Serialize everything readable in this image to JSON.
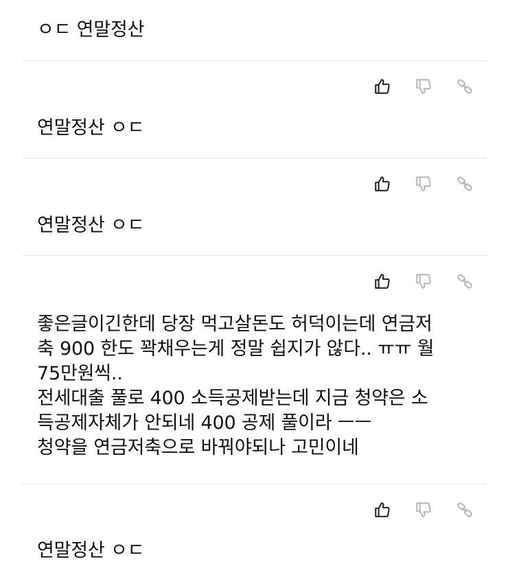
{
  "comments": [
    {
      "text": "ㅇㄷ 연말정산"
    },
    {
      "text": "연말정산 ㅇㄷ"
    },
    {
      "text": "연말정산 ㅇㄷ"
    },
    {
      "text": "좋은글이긴한데 당장 먹고살돈도 허덕이는데 연금저\n축 900 한도 꽉채우는게 정말 쉽지가 않다.. ㅠㅠ 월\n75만원씩..\n전세대출 풀로 400 소득공제받는데 지금 청약은 소\n득공제자체가 안되네 400 공제 풀이라 ㅡㅡ\n청약을 연금저축으로 바꿔야되나 고민이네"
    },
    {
      "text": "연말정산 ㅇㄷ"
    }
  ],
  "icons": {
    "like": "thumbs-up-icon",
    "dislike": "thumbs-down-icon",
    "share": "link-icon"
  },
  "colors": {
    "like_icon": "#1a1a1a",
    "inactive_icon": "#b5b5b5",
    "divider": "#e6e6e6",
    "text": "#111111"
  }
}
